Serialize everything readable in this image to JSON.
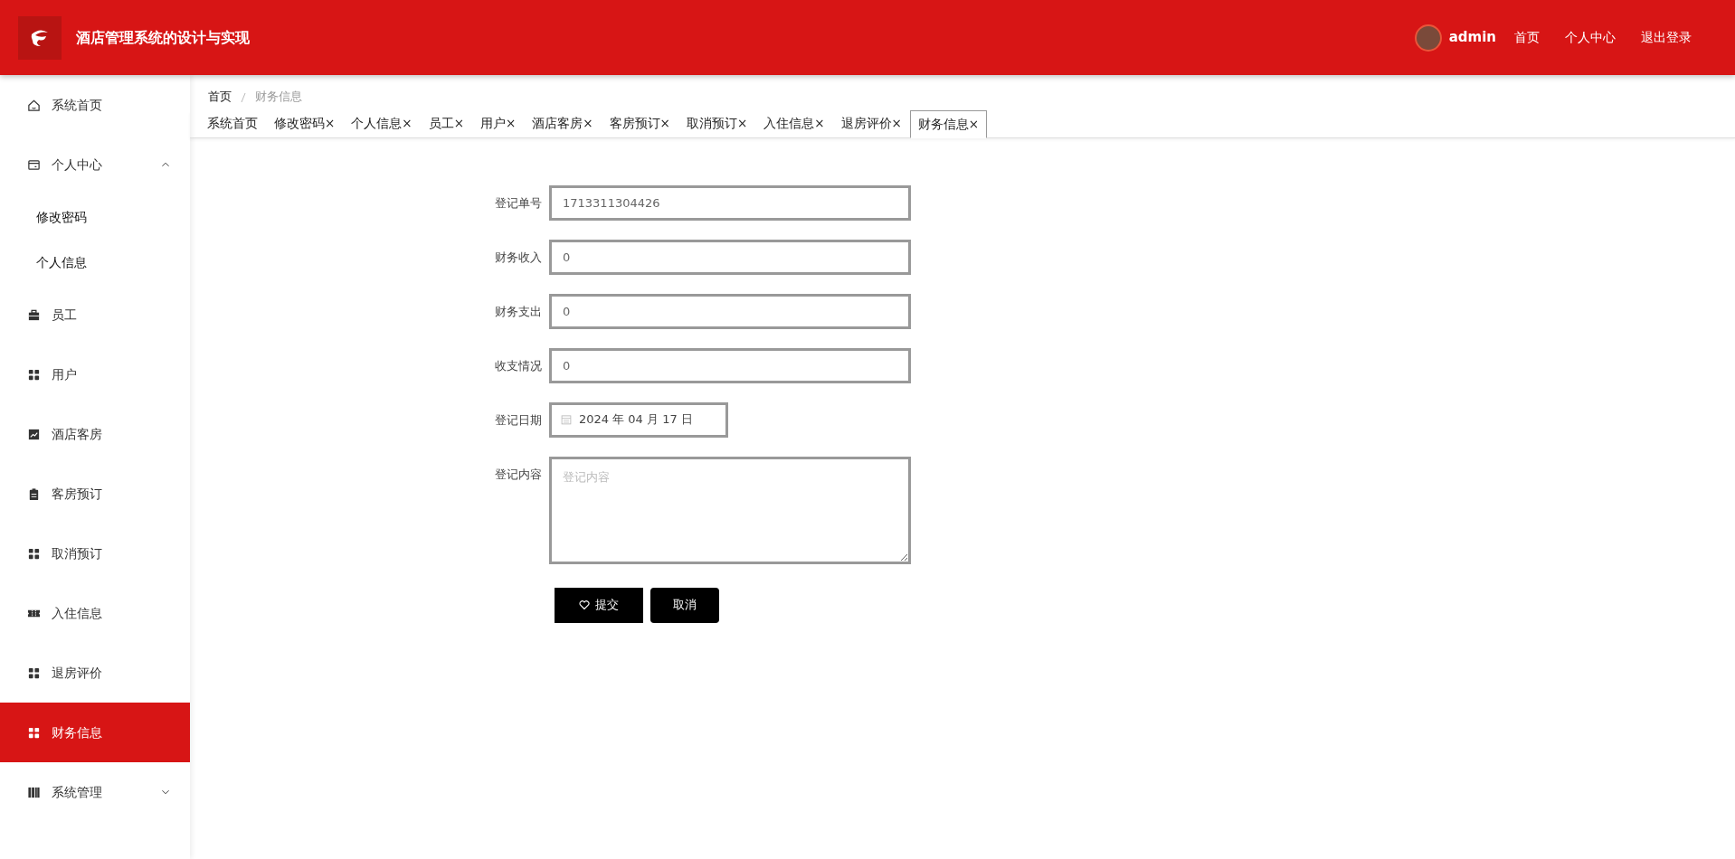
{
  "header": {
    "title": "酒店管理系统的设计与实现",
    "user": "admin",
    "links": [
      "首页",
      "个人中心",
      "退出登录"
    ]
  },
  "sidebar": {
    "items": [
      {
        "label": "系统首页",
        "selected": false
      },
      {
        "label": "个人中心",
        "selected": false,
        "expanded": true,
        "children": [
          {
            "label": "修改密码",
            "selected": false
          },
          {
            "label": "个人信息",
            "selected": false
          }
        ]
      },
      {
        "label": "员工",
        "selected": false
      },
      {
        "label": "用户",
        "selected": false
      },
      {
        "label": "酒店客房",
        "selected": false
      },
      {
        "label": "客房预订",
        "selected": false
      },
      {
        "label": "取消预订",
        "selected": false
      },
      {
        "label": "入住信息",
        "selected": false
      },
      {
        "label": "退房评价",
        "selected": false
      },
      {
        "label": "财务信息",
        "selected": true
      },
      {
        "label": "系统管理",
        "selected": false,
        "expanded": false
      }
    ]
  },
  "breadcrumb": [
    "首页",
    "财务信息"
  ],
  "tabs": [
    {
      "label": "系统首页",
      "selected": false
    },
    {
      "label": "修改密码",
      "close": "×",
      "selected": false
    },
    {
      "label": "个人信息",
      "close": "×",
      "selected": false
    },
    {
      "label": "员工",
      "close": "×",
      "selected": false
    },
    {
      "label": "用户",
      "close": "×",
      "selected": false
    },
    {
      "label": "酒店客房",
      "close": "×",
      "selected": false
    },
    {
      "label": "客房预订",
      "close": "×",
      "selected": false
    },
    {
      "label": "取消预订",
      "close": "×",
      "selected": false
    },
    {
      "label": "入住信息",
      "close": "×",
      "selected": false
    },
    {
      "label": "退房评价",
      "close": "×",
      "selected": false
    },
    {
      "label": "财务信息",
      "close": "×",
      "selected": true
    }
  ],
  "form": {
    "fields": [
      {
        "kind": "text",
        "label": "登记单号",
        "value": "1713311304426"
      },
      {
        "kind": "text",
        "label": "财务收入",
        "value": "0"
      },
      {
        "kind": "text",
        "label": "财务支出",
        "value": "0"
      },
      {
        "kind": "text",
        "label": "收支情况",
        "value": "0"
      },
      {
        "kind": "date",
        "label": "登记日期",
        "value": "2024 年 04 月 17 日"
      },
      {
        "kind": "textarea",
        "label": "登记内容",
        "placeholder": "登记内容"
      }
    ],
    "buttons": [
      {
        "kind": "submit",
        "label": "提交"
      },
      {
        "kind": "cancel",
        "label": "取消"
      }
    ]
  }
}
